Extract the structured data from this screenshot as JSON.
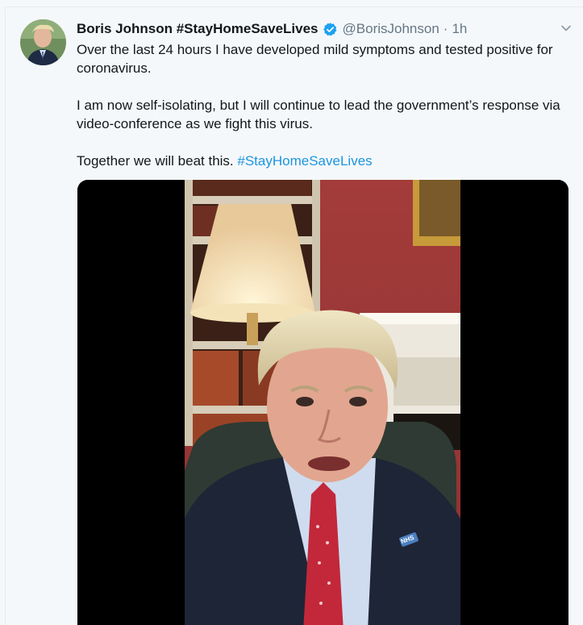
{
  "tweet": {
    "display_name": "Boris Johnson #StayHomeSaveLives",
    "handle": "@BorisJohnson",
    "separator": "·",
    "timestamp": "1h",
    "paragraphs": [
      "Over the last 24 hours I have developed mild symptoms and tested positive for coronavirus.",
      "I am now self-isolating, but I will continue to lead the government’s response via video-conference as we fight this virus."
    ],
    "closing_text": "Together we will beat this. ",
    "hashtag": "#StayHomeSaveLives",
    "media_badge": "NHS"
  },
  "icons": {
    "verified": "verified-badge-icon",
    "caret": "chevron-down-icon"
  },
  "colors": {
    "link": "#1b95e0",
    "verified": "#1da1f2",
    "text": "#14171a",
    "secondary_text": "#657786",
    "background": "#f5f8fa"
  }
}
